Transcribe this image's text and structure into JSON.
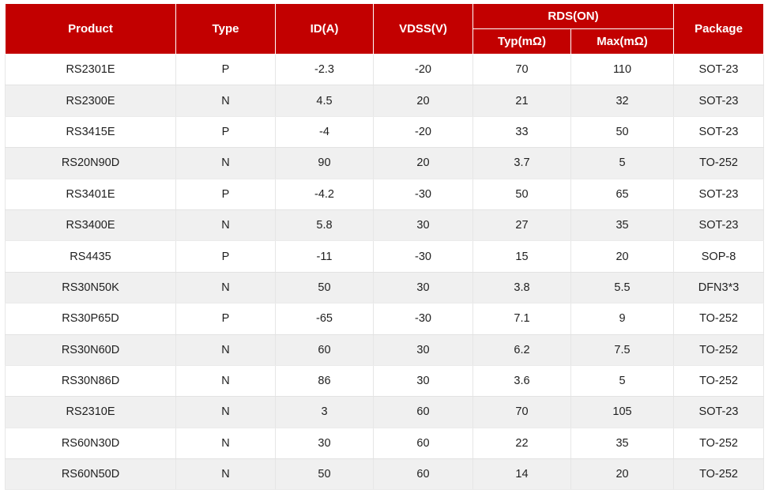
{
  "table": {
    "headers": {
      "product": "Product",
      "type": "Type",
      "id": "ID(A)",
      "vdss": "VDSS(V)",
      "rds_group": "RDS(ON)",
      "rds_typ": "Typ(mΩ)",
      "rds_max": "Max(mΩ)",
      "package": "Package"
    },
    "header_bg": "#c20000",
    "header_text_color": "#ffffff",
    "stripe_color": "#f0f0f0",
    "rows": [
      {
        "product": "RS2301E",
        "type": "P",
        "id": "-2.3",
        "vdss": "-20",
        "typ": "70",
        "max": "110",
        "package": "SOT-23"
      },
      {
        "product": "RS2300E",
        "type": "N",
        "id": "4.5",
        "vdss": "20",
        "typ": "21",
        "max": "32",
        "package": "SOT-23"
      },
      {
        "product": "RS3415E",
        "type": "P",
        "id": "-4",
        "vdss": "-20",
        "typ": "33",
        "max": "50",
        "package": "SOT-23"
      },
      {
        "product": "RS20N90D",
        "type": "N",
        "id": "90",
        "vdss": "20",
        "typ": "3.7",
        "max": "5",
        "package": "TO-252"
      },
      {
        "product": "RS3401E",
        "type": "P",
        "id": "-4.2",
        "vdss": "-30",
        "typ": "50",
        "max": "65",
        "package": "SOT-23"
      },
      {
        "product": "RS3400E",
        "type": "N",
        "id": "5.8",
        "vdss": "30",
        "typ": "27",
        "max": "35",
        "package": "SOT-23"
      },
      {
        "product": "RS4435",
        "type": "P",
        "id": "-11",
        "vdss": "-30",
        "typ": "15",
        "max": "20",
        "package": "SOP-8"
      },
      {
        "product": "RS30N50K",
        "type": "N",
        "id": "50",
        "vdss": "30",
        "typ": "3.8",
        "max": "5.5",
        "package": "DFN3*3"
      },
      {
        "product": "RS30P65D",
        "type": "P",
        "id": "-65",
        "vdss": "-30",
        "typ": "7.1",
        "max": "9",
        "package": "TO-252"
      },
      {
        "product": "RS30N60D",
        "type": "N",
        "id": "60",
        "vdss": "30",
        "typ": "6.2",
        "max": "7.5",
        "package": "TO-252"
      },
      {
        "product": "RS30N86D",
        "type": "N",
        "id": "86",
        "vdss": "30",
        "typ": "3.6",
        "max": "5",
        "package": "TO-252"
      },
      {
        "product": "RS2310E",
        "type": "N",
        "id": "3",
        "vdss": "60",
        "typ": "70",
        "max": "105",
        "package": "SOT-23"
      },
      {
        "product": "RS60N30D",
        "type": "N",
        "id": "30",
        "vdss": "60",
        "typ": "22",
        "max": "35",
        "package": "TO-252"
      },
      {
        "product": "RS60N50D",
        "type": "N",
        "id": "50",
        "vdss": "60",
        "typ": "14",
        "max": "20",
        "package": "TO-252"
      }
    ]
  }
}
